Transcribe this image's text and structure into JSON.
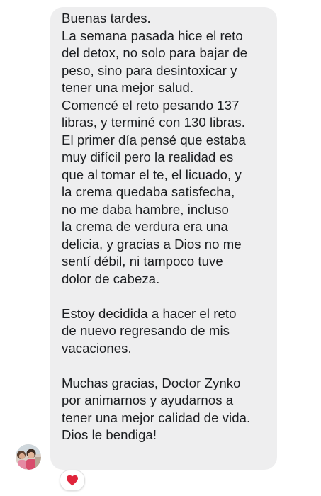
{
  "message": {
    "lines": [
      "Buenas tardes.",
      "La semana pasada hice el reto",
      "del detox, no solo para bajar de",
      "peso, sino para desintoxicar y",
      "tener una mejor salud.",
      "Comencé el reto pesando 137",
      "libras, y terminé con 130 libras.",
      "El primer día pensé que estaba",
      "muy difícil pero la realidad es",
      "que al tomar el te, el licuado, y",
      "la crema quedaba satisfecha,",
      "no me daba hambre, incluso",
      "la crema de verdura era una",
      "delicia, y gracias a Dios no me",
      "sentí débil, ni tampoco tuve",
      "dolor de cabeza.",
      "",
      "Estoy decidida a hacer el reto",
      "de nuevo regresando de mis",
      "vacaciones.",
      "",
      "Muchas gracias, Doctor Zynko",
      "por animarnos y ayudarnos a",
      "tener una mejor calidad de vida.",
      "Dios le bendiga!"
    ]
  },
  "reaction": {
    "icon": "heart-icon",
    "color": "#e0243b"
  },
  "colors": {
    "bubble_background": "#eeeeef",
    "text": "#1c1e21",
    "page_background": "#ffffff"
  }
}
